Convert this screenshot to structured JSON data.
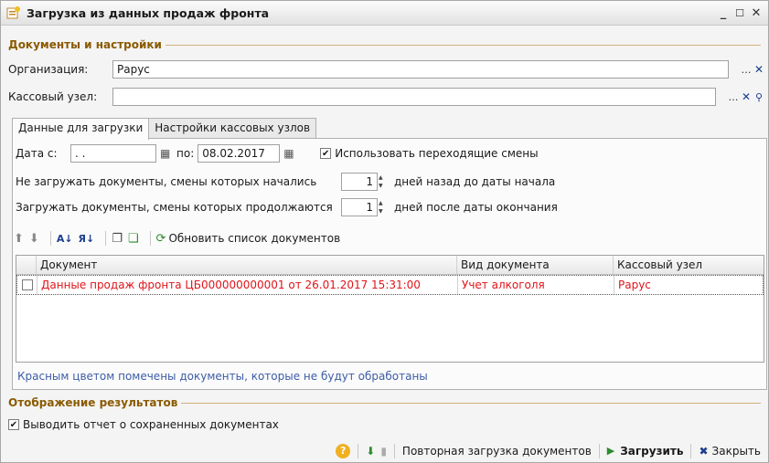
{
  "window": {
    "title": "Загрузка из данных продаж фронта",
    "minimize": "_",
    "restore": "☐",
    "close": "✕"
  },
  "section1": {
    "label": "Документы и настройки"
  },
  "org": {
    "label": "Организация:",
    "value": "Рарус"
  },
  "cash_node": {
    "label": "Кассовый узел:",
    "value": ""
  },
  "tabs": [
    {
      "label": "Данные для загрузки"
    },
    {
      "label": "Настройки кассовых узлов"
    }
  ],
  "dates": {
    "from_label": "Дата с:",
    "from_value": " .  .",
    "to_label": "по:",
    "to_value": "08.02.2017"
  },
  "use_shifts": {
    "label": "Использовать переходящие смены",
    "checked": true
  },
  "no_load": {
    "label": "Не загружать документы, смены которых начались",
    "value": "1",
    "suffix": "дней назад до даты начала"
  },
  "do_load": {
    "label": "Загружать документы, смены которых продолжаются",
    "value": "1",
    "suffix": "дней после даты окончания"
  },
  "toolbar": {
    "refresh_label": "Обновить список документов"
  },
  "grid": {
    "columns": [
      "Документ",
      "Вид документа",
      "Кассовый узел"
    ],
    "rows": [
      {
        "doc": "Данные продаж фронта ЦБ000000000001 от 26.01.2017 15:31:00",
        "type": "Учет алкоголя",
        "node": "Рарус",
        "checked": false
      }
    ]
  },
  "note": "Красным цветом помечены документы, которые не будут обработаны",
  "section2": {
    "label": "Отображение результатов"
  },
  "report": {
    "label": "Выводить отчет о сохраненных документах",
    "checked": true
  },
  "footer": {
    "help": "?",
    "reload_label": "Повторная загрузка документов",
    "load_label": "Загрузить",
    "close_label": "Закрыть"
  },
  "colors": {
    "accent": "#8b5a00",
    "error": "#e0141a",
    "note": "#3d5da6"
  }
}
